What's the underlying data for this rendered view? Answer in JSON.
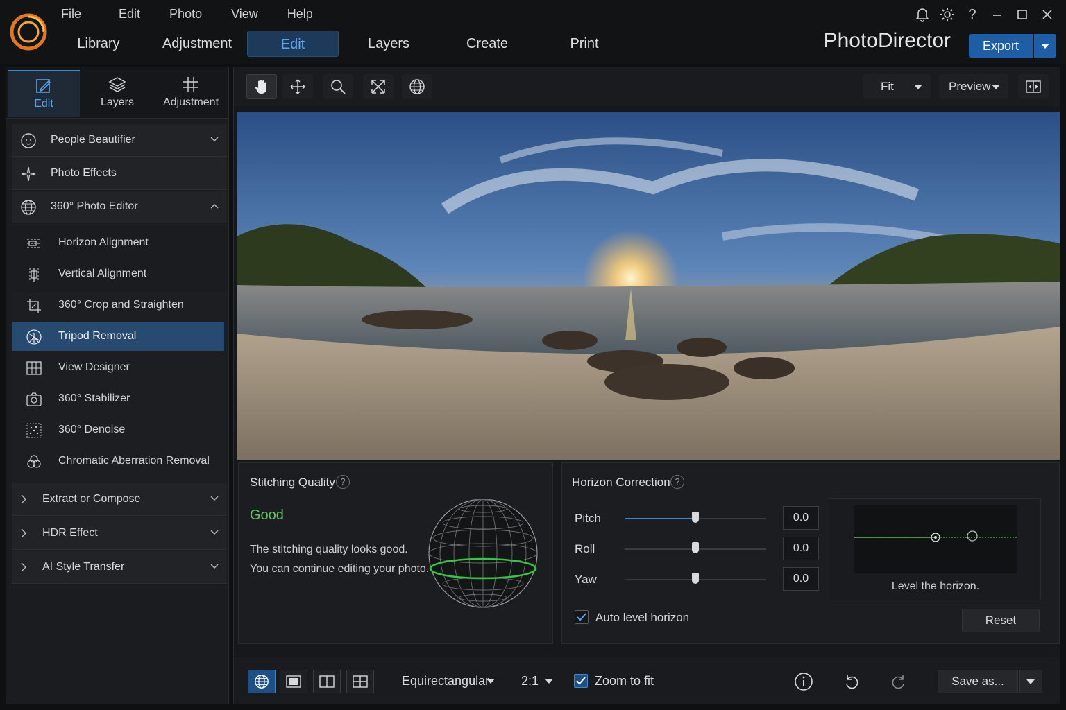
{
  "menu": [
    "File",
    "Edit",
    "Photo",
    "View",
    "Help"
  ],
  "main_tabs": [
    "Library",
    "Adjustment",
    "Edit",
    "Layers",
    "Create",
    "Print"
  ],
  "active_main_tab": "Edit",
  "app_title": "PhotoDirector",
  "export_label": "Export",
  "left_tabs": [
    "Edit",
    "Layers",
    "Adjustment"
  ],
  "sections": {
    "people_beautifier": "People Beautifier",
    "photo_effects": "Photo Effects",
    "photo_360_editor": "360° Photo Editor",
    "extract_compose": "Extract or Compose",
    "hdr_effect": "HDR Effect",
    "ai_style_transfer": "AI Style Transfer"
  },
  "sub_items": [
    "Horizon Alignment",
    "Vertical Alignment",
    "360° Crop and Straighten",
    "Tripod Removal",
    "View Designer",
    "360° Stabilizer",
    "360° Denoise",
    "Chromatic Aberration Removal"
  ],
  "active_sub_item": "Tripod Removal",
  "toolbar": {
    "fit_label": "Fit",
    "preview_label": "Preview"
  },
  "stitching": {
    "title": "Stitching Quality",
    "help": "?",
    "quality": "Good",
    "line1": "The stitching quality looks good.",
    "line2": "You can continue editing your photo.",
    "quality_color": "#5cc764"
  },
  "horizon": {
    "title": "Horizon Correction",
    "help": "?",
    "sliders": [
      {
        "label": "Pitch",
        "value": "0.0",
        "position": 0.5
      },
      {
        "label": "Roll",
        "value": "0.0",
        "position": 0.5
      },
      {
        "label": "Yaw",
        "value": "0.0",
        "position": 0.5
      }
    ],
    "caption": "Level the horizon.",
    "auto_level_label": "Auto level horizon",
    "auto_level_checked": true,
    "reset_label": "Reset"
  },
  "bottombar": {
    "projection": "Equirectangular",
    "ratio": "2:1",
    "zoom_to_fit_label": "Zoom to fit",
    "zoom_to_fit_checked": true,
    "save_as_label": "Save as..."
  },
  "colors": {
    "accent": "#3b86d6",
    "export_bg": "#1e5ea6",
    "active_item_bg": "#274a71"
  }
}
